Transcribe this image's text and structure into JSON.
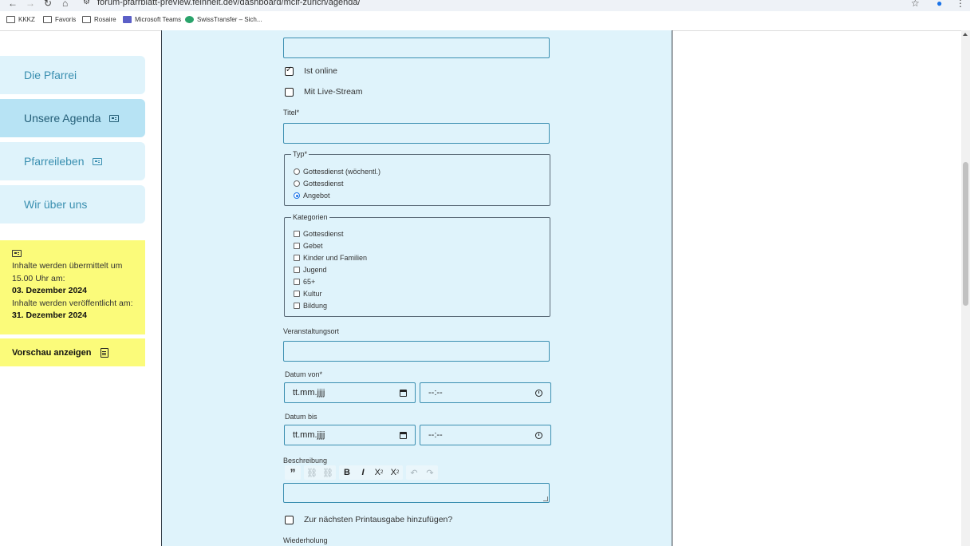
{
  "browser": {
    "url": "forum-pfarrblatt-preview.feinheit.dev/dashboard/mcif-zurich/agenda/",
    "bookmarks": [
      "KKKZ",
      "Favoris",
      "Rosaire",
      "Microsoft Teams",
      "SwissTransfer – Sich..."
    ]
  },
  "sidebar": {
    "items": [
      {
        "label": "Die Pfarrei"
      },
      {
        "label": "Unsere Agenda"
      },
      {
        "label": "Pfarreileben"
      },
      {
        "label": "Wir über uns"
      }
    ],
    "info": {
      "line1": "Inhalte werden übermittelt um 15.00 Uhr am:",
      "date1": "03. Dezember 2024",
      "line2": "Inhalte werden veröffentlicht am:",
      "date2": "31. Dezember 2024"
    },
    "preview_label": "Vorschau anzeigen"
  },
  "form": {
    "online_label": "Ist online",
    "online_checked": true,
    "livestream_label": "Mit Live-Stream",
    "livestream_checked": false,
    "title_label": "Titel*",
    "type_legend": "Typ*",
    "type_options": [
      "Gottesdienst (wöchentl.)",
      "Gottesdienst",
      "Angebot"
    ],
    "type_selected": "Angebot",
    "categories_legend": "Kategorien",
    "categories": [
      "Gottesdienst",
      "Gebet",
      "Kinder und Familien",
      "Jugend",
      "65+",
      "Kultur",
      "Bildung"
    ],
    "location_label": "Veranstaltungsort",
    "date_from_label": "Datum von*",
    "date_to_label": "Datum bis",
    "date_placeholder": "tt.mm.jjjj",
    "time_placeholder": "--:--",
    "description_label": "Beschreibung",
    "print_label": "Zur nächsten Printausgabe hinzufügen?",
    "recurrence_label": "Wiederholung"
  },
  "colors": {
    "panel_bg": "#dff3fb",
    "field_border": "#3b8fb1",
    "sidebar_active": "#b7e3f4",
    "info_bg": "#fbfb7a"
  }
}
